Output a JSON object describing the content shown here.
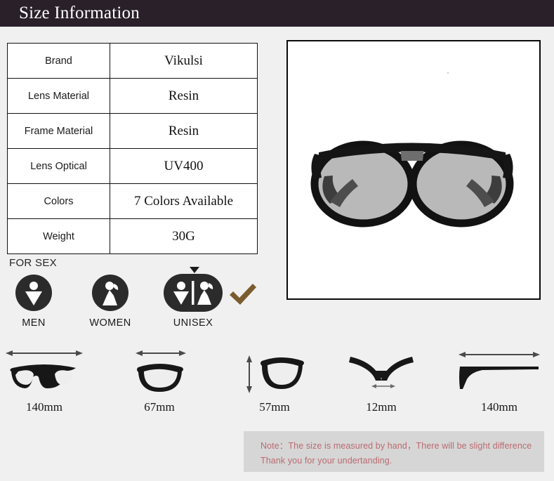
{
  "header": {
    "title": "Size Information",
    "bar_color": "#2a2029",
    "text_color": "#ffffff"
  },
  "page": {
    "background": "#f0f0f0"
  },
  "spec_table": {
    "rows": [
      {
        "label": "Brand",
        "value": "Vikulsi"
      },
      {
        "label": "Lens Material",
        "value": "Resin"
      },
      {
        "label": "Frame Material",
        "value": "Resin"
      },
      {
        "label": "Lens Optical",
        "value": "UV400"
      },
      {
        "label": "Colors",
        "value": "7 Colors Available"
      },
      {
        "label": "Weight",
        "value": "30G"
      }
    ]
  },
  "product_photo": {
    "alt": "black aviator sunglasses with silver mirrored lenses",
    "frame_color": "#0a0a0a",
    "background": "#ffffff",
    "lens_color": "#b5b5b5",
    "temple_color": "#4a4a4a"
  },
  "for_sex": {
    "label": "FOR SEX",
    "selected": "UNISEX",
    "check_color": "#7a5c2e",
    "icon_color": "#2b2b2b",
    "options": [
      {
        "caption": "MEN",
        "icon": "male-figure-icon"
      },
      {
        "caption": "WOMEN",
        "icon": "female-figure-icon"
      },
      {
        "caption": "UNISEX",
        "icon": "unisex-figures-icon"
      }
    ]
  },
  "measurements": [
    {
      "value": "140mm",
      "icon": "frame-total-width-icon",
      "dimension": "total frame width"
    },
    {
      "value": "67mm",
      "icon": "lens-width-icon",
      "dimension": "lens width"
    },
    {
      "value": "57mm",
      "icon": "lens-height-icon",
      "dimension": "lens height"
    },
    {
      "value": "12mm",
      "icon": "bridge-width-icon",
      "dimension": "bridge width"
    },
    {
      "value": "140mm",
      "icon": "temple-length-icon",
      "dimension": "temple length"
    }
  ],
  "note": {
    "line1": "Note：The size is measured by hand，There will be slight difference",
    "line2": "Thank you for your undertanding.",
    "text_color": "#bb6a70",
    "background": "#d6d6d6"
  }
}
